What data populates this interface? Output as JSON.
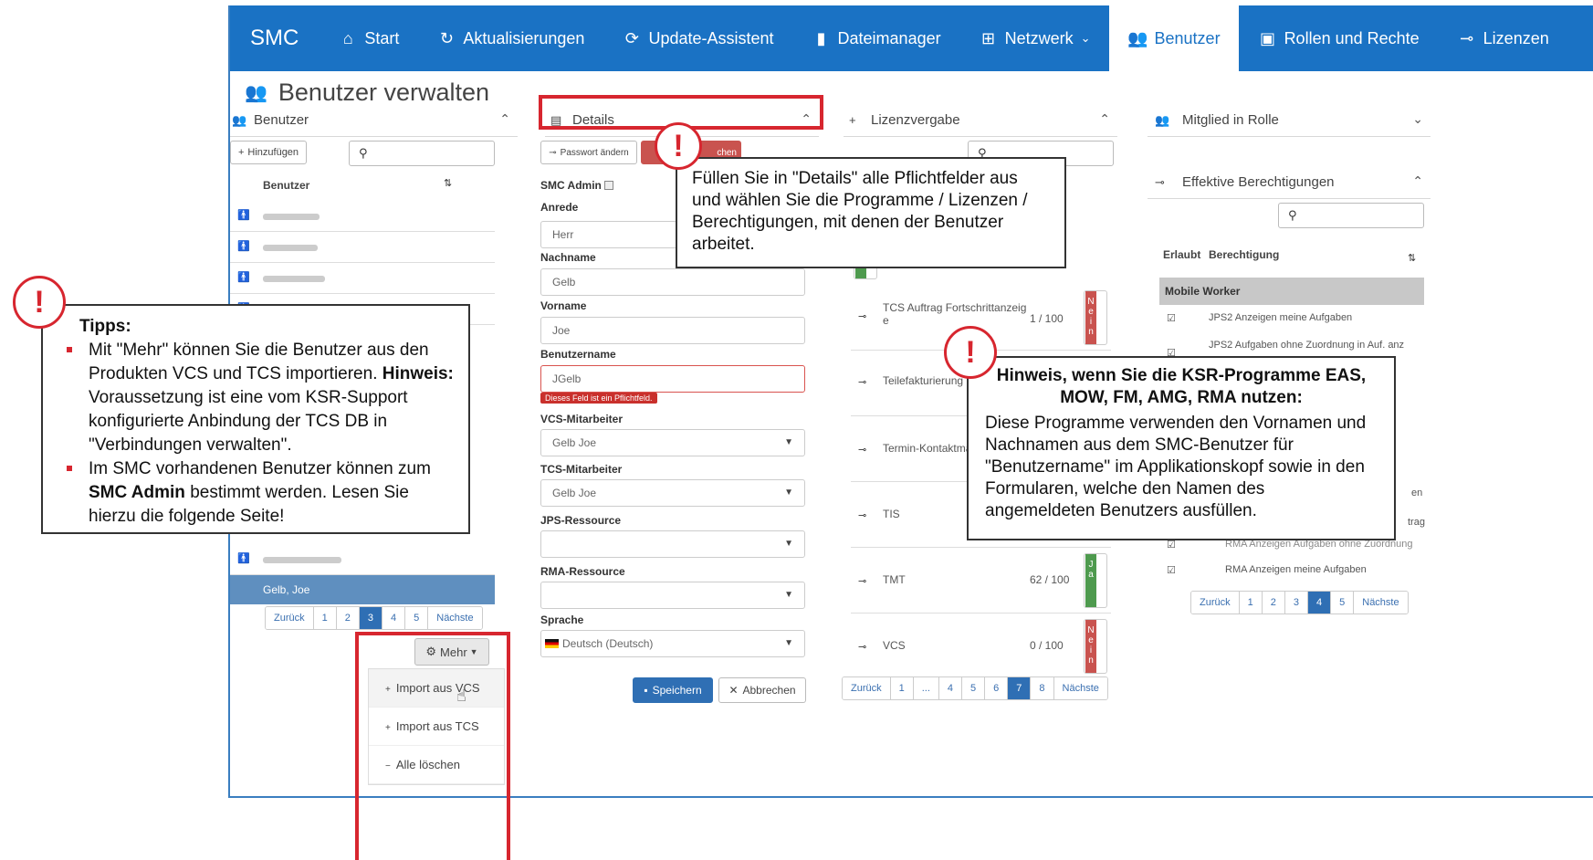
{
  "nav": {
    "brand": "SMC",
    "items": [
      {
        "label": "Start",
        "icon": "home-icon"
      },
      {
        "label": "Aktualisierungen",
        "icon": "refresh-icon"
      },
      {
        "label": "Update-Assistent",
        "icon": "update-icon"
      },
      {
        "label": "Dateimanager",
        "icon": "file-icon"
      },
      {
        "label": "Netzwerk",
        "icon": "network-icon"
      },
      {
        "label": "Benutzer",
        "icon": "users-icon"
      },
      {
        "label": "Rollen und Rechte",
        "icon": "roles-icon"
      },
      {
        "label": "Lizenzen",
        "icon": "key-icon"
      }
    ]
  },
  "page_title": "Benutzer verwalten",
  "users_panel": {
    "title": "Benutzer",
    "add_label": "Hinzufügen",
    "column_header": "Benutzer",
    "selected_user": "Gelb, Joe",
    "pagination": [
      "Zurück",
      "1",
      "2",
      "3",
      "4",
      "5",
      "Nächste"
    ],
    "current_page": "3",
    "more_label": "Mehr",
    "more_menu": [
      "Import aus VCS",
      "Import aus TCS",
      "Alle löschen"
    ]
  },
  "details_panel": {
    "title": "Details",
    "change_password_label": "Passwort ändern",
    "delete_label_partial": "chen",
    "smc_admin_label": "SMC Admin",
    "fields": {
      "anrede_label": "Anrede",
      "anrede_value": "Herr",
      "nachname_label": "Nachname",
      "nachname_value": "Gelb",
      "vorname_label": "Vorname",
      "vorname_value": "Joe",
      "benutzername_label": "Benutzername",
      "benutzername_value": "JGelb",
      "required_error": "Dieses Feld ist ein Pflichtfeld.",
      "vcs_label": "VCS-Mitarbeiter",
      "vcs_value": "Gelb Joe",
      "tcs_label": "TCS-Mitarbeiter",
      "tcs_value": "Gelb Joe",
      "jps_label": "JPS-Ressource",
      "jps_value": "",
      "rma_label": "RMA-Ressource",
      "rma_value": "",
      "sprache_label": "Sprache",
      "sprache_value": "Deutsch (Deutsch)"
    },
    "save_label": "Speichern",
    "cancel_label": "Abbrechen"
  },
  "license_panel": {
    "title": "Lizenzvergabe",
    "rows": [
      {
        "name": "TCS Auftrag Fortschrittanzeig",
        "name2": "e",
        "count": "1 / 100",
        "state": "Nein",
        "color": "#c9534f"
      },
      {
        "name": "Teilefakturierung",
        "name2": "",
        "count": "",
        "state": "",
        "color": ""
      },
      {
        "name": "Termin-Kontaktma",
        "name2": "",
        "count": "",
        "state": "",
        "color": ""
      },
      {
        "name": "TIS",
        "name2": "",
        "count": "",
        "state": "",
        "color": ""
      },
      {
        "name": "TMT",
        "name2": "",
        "count": "62 / 100",
        "state": "Ja",
        "color": "#4e9a4e"
      },
      {
        "name": "VCS",
        "name2": "",
        "count": "0 / 100",
        "state": "Nein",
        "color": "#c9534f"
      }
    ],
    "top_toggle": "Ja",
    "pagination": [
      "Zurück",
      "1",
      "...",
      "4",
      "5",
      "6",
      "7",
      "8",
      "Nächste"
    ],
    "current_page": "7"
  },
  "role_panel": {
    "title": "Mitglied in Rolle",
    "perm_title": "Effektive Berechtigungen",
    "col_allowed": "Erlaubt",
    "col_perm": "Berechtigung",
    "group": "Mobile Worker",
    "rows": [
      "JPS2 Anzeigen meine Aufgaben",
      "JPS2 Aufgaben ohne Zuordnung in Auf. anz",
      "en",
      "trag",
      "RMA Anzeigen Aufgaben ohne Zuordnung",
      "RMA Anzeigen meine Aufgaben"
    ],
    "pagination": [
      "Zurück",
      "1",
      "2",
      "3",
      "4",
      "5",
      "Nächste"
    ],
    "current_page": "4"
  },
  "callouts": {
    "details_text": "Füllen Sie in \"Details\" alle Pflichtfelder aus und wählen Sie die Programme / Lizenzen / Berechtigungen, mit denen der Benutzer arbeitet.",
    "tips_title": "Tipps:",
    "tips_1a": "Mit \"Mehr\" können Sie die Benutzer aus den Produkten VCS und TCS importieren.",
    "tips_1b_bold": "Hinweis:",
    "tips_1c": "Voraussetzung ist eine vom KSR-Support konfigurierte Anbindung der TCS DB in \"Verbindungen verwalten\".",
    "tips_2a": "Im SMC vorhandenen Benutzer können zum",
    "tips_2b_bold": "SMC Admin",
    "tips_2c": "bestimmt werden. Lesen Sie hierzu die folgende Seite!",
    "ksr_title": "Hinweis, wenn Sie die KSR-Programme EAS, MOW, FM, AMG, RMA nutzen:",
    "ksr_text": "Diese Programme verwenden den Vornamen und Nachnamen aus dem SMC-Benutzer für \"Benutzername\" im Applikationskopf sowie in den Formularen, welche den Namen des angemeldeten Benutzers ausfüllen.",
    "mark": "!"
  }
}
